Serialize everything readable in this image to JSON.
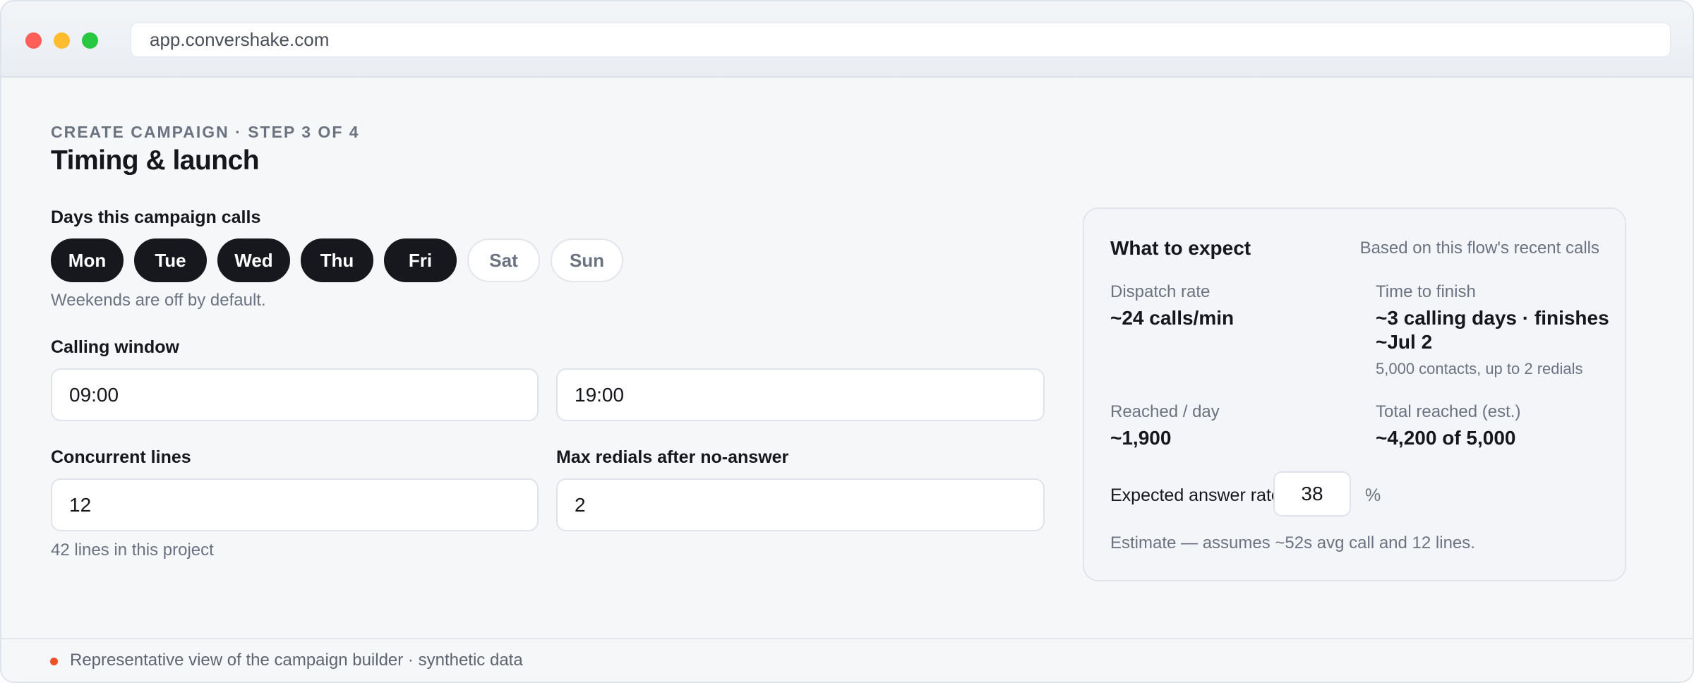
{
  "browser": {
    "url": "app.convershake.com"
  },
  "page": {
    "step_label": "CREATE CAMPAIGN · STEP 3 OF 4",
    "title": "Timing & launch"
  },
  "days": {
    "label": "Days this campaign calls",
    "items": [
      {
        "label": "Mon",
        "selected": true
      },
      {
        "label": "Tue",
        "selected": true
      },
      {
        "label": "Wed",
        "selected": true
      },
      {
        "label": "Thu",
        "selected": true
      },
      {
        "label": "Fri",
        "selected": true
      },
      {
        "label": "Sat",
        "selected": false
      },
      {
        "label": "Sun",
        "selected": false
      }
    ],
    "hint": "Weekends are off by default."
  },
  "calling_window": {
    "label": "Calling window",
    "start": "09:00",
    "end": "19:00"
  },
  "concurrent_lines": {
    "label": "Concurrent lines",
    "value": "12",
    "hint": "42 lines in this project"
  },
  "max_redials": {
    "label": "Max redials after no-answer",
    "value": "2"
  },
  "expect": {
    "title": "What to expect",
    "subtitle": "Based on this flow's recent calls",
    "dispatch_rate": {
      "label": "Dispatch rate",
      "value": "~24 calls/min"
    },
    "time_to_finish": {
      "label": "Time to finish",
      "value_line1": "~3 calling days · finishes",
      "value_line2": "~Jul 2",
      "note": "5,000 contacts, up to 2 redials"
    },
    "reached_per_day": {
      "label": "Reached / day",
      "value": "~1,900"
    },
    "total_reached": {
      "label": "Total reached (est.)",
      "value": "~4,200 of 5,000"
    },
    "answer_rate": {
      "label": "Expected answer rate",
      "value": "38",
      "unit": "%"
    },
    "footnote": "Estimate — assumes ~52s avg call and 12 lines."
  },
  "footer": {
    "text": "Representative view of the campaign builder · synthetic data",
    "dot_color": "#f04e23"
  },
  "colors": {
    "accent_dark": "#16181d",
    "muted_text": "#6b7280",
    "traffic_red": "#ff5f57",
    "traffic_yellow": "#febc2e",
    "traffic_green": "#28c840"
  }
}
